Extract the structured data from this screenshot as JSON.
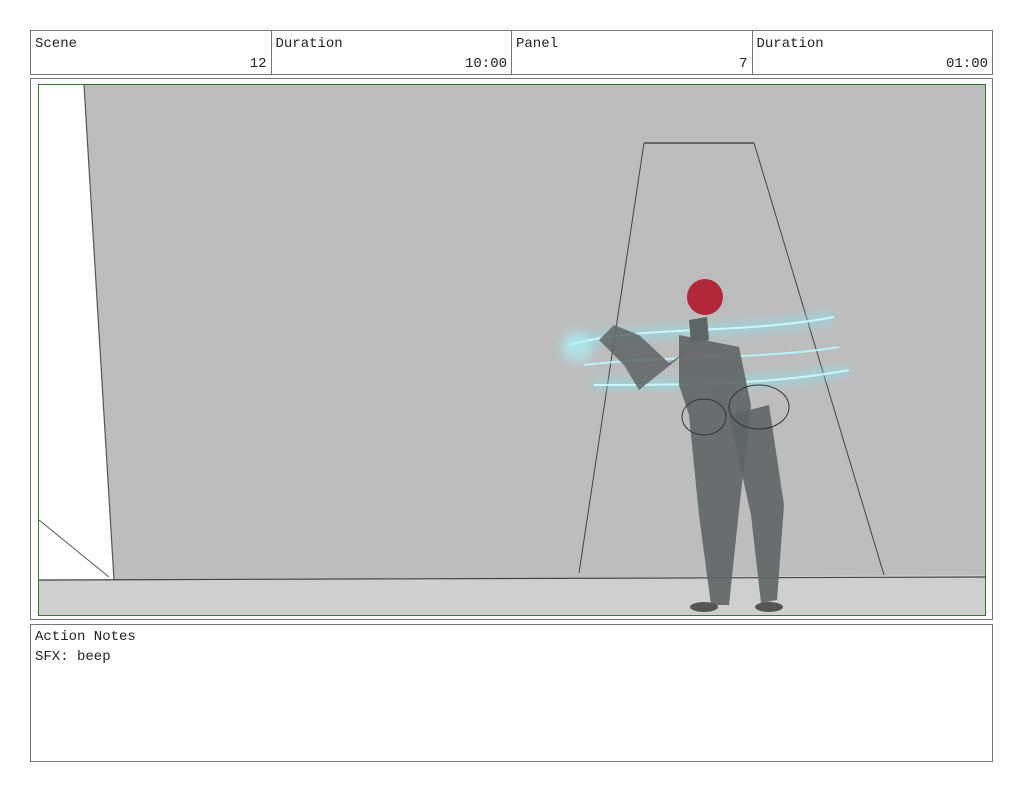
{
  "header": {
    "scene": {
      "label": "Scene",
      "value": "12"
    },
    "scene_duration": {
      "label": "Duration",
      "value": "10:00"
    },
    "panel": {
      "label": "Panel",
      "value": "7"
    },
    "panel_duration": {
      "label": "Duration",
      "value": "01:00"
    }
  },
  "notes": {
    "title": "Action Notes",
    "text": "SFX: beep"
  },
  "colors": {
    "frame_border": "#2f7a2f",
    "wall": "#bdbdbd",
    "floor": "#cfcfcf",
    "hair": "#b0283a",
    "glow": "#7fe8f5",
    "figure": "#5f6464"
  }
}
